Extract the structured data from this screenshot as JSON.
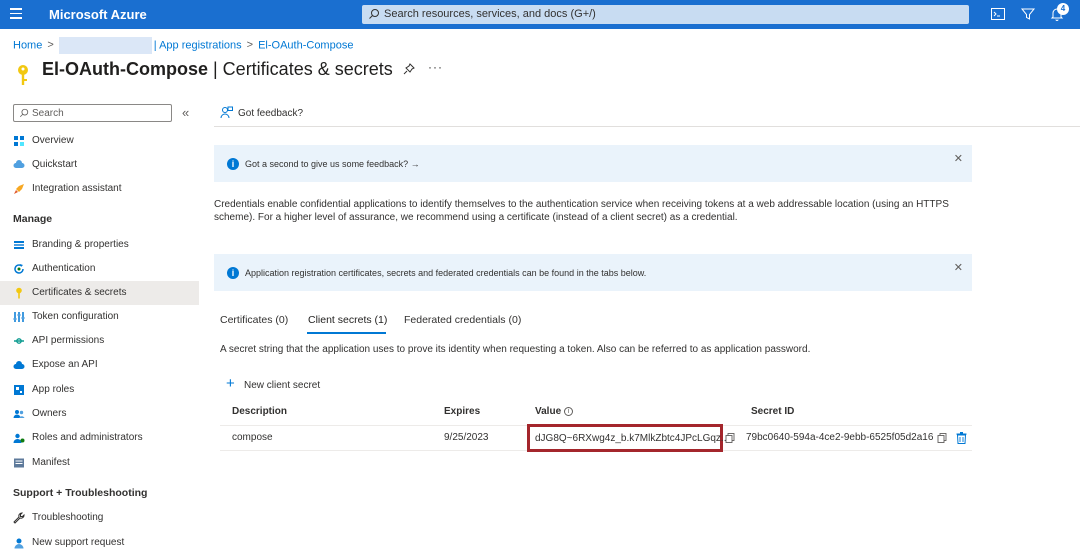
{
  "topbar": {
    "brand": "Microsoft Azure",
    "search_placeholder": "Search resources, services, and docs (G+/)",
    "notification_count": "4"
  },
  "breadcrumb": {
    "home": "Home",
    "app_registrations": "| App registrations",
    "current": "El-OAuth-Compose"
  },
  "page": {
    "title_bold": "El-OAuth-Compose",
    "title_rest": " | Certificates & secrets",
    "more": "···"
  },
  "sidebar": {
    "search_placeholder": "Search",
    "items_top": [
      {
        "label": "Overview",
        "icon": "grid-icon"
      },
      {
        "label": "Quickstart",
        "icon": "cloud-bolt-icon"
      },
      {
        "label": "Integration assistant",
        "icon": "rocket-icon"
      }
    ],
    "manage_heading": "Manage",
    "manage_items": [
      {
        "label": "Branding & properties",
        "icon": "list-icon"
      },
      {
        "label": "Authentication",
        "icon": "refresh-icon"
      },
      {
        "label": "Certificates & secrets",
        "icon": "key-icon",
        "active": true
      },
      {
        "label": "Token configuration",
        "icon": "sliders-icon"
      },
      {
        "label": "API permissions",
        "icon": "permissions-icon"
      },
      {
        "label": "Expose an API",
        "icon": "cloud-icon"
      },
      {
        "label": "App roles",
        "icon": "app-roles-icon"
      },
      {
        "label": "Owners",
        "icon": "people-icon"
      },
      {
        "label": "Roles and administrators",
        "icon": "admin-icon"
      },
      {
        "label": "Manifest",
        "icon": "manifest-icon"
      }
    ],
    "support_heading": "Support + Troubleshooting",
    "support_items": [
      {
        "label": "Troubleshooting",
        "icon": "wrench-icon"
      },
      {
        "label": "New support request",
        "icon": "support-icon"
      }
    ]
  },
  "main": {
    "feedback": "Got feedback?",
    "banner1": "Got a second to give us some feedback? →",
    "description": "Credentials enable confidential applications to identify themselves to the authentication service when receiving tokens at a web addressable location (using an HTTPS scheme). For a higher level of assurance, we recommend using a certificate (instead of a client secret) as a credential.",
    "banner2": "Application registration certificates, secrets and federated credentials can be found in the tabs below.",
    "tabs": [
      "Certificates (0)",
      "Client secrets (1)",
      "Federated credentials (0)"
    ],
    "tab_description": "A secret string that the application uses to prove its identity when requesting a token. Also can be referred to as application password.",
    "new_secret": "New client secret",
    "table": {
      "headers": [
        "Description",
        "Expires",
        "Value",
        "Secret ID"
      ],
      "rows": [
        {
          "description": "compose",
          "expires": "9/25/2023",
          "value": "dJG8Q~6RXwg4z_b.k7MlkZbtc4JPcLGqz...",
          "secret_id": "79bc0640-594a-4ce2-9ebb-6525f05d2a16"
        }
      ]
    }
  },
  "colors": {
    "topbar": "#1a6fd0",
    "accent": "#0078d4",
    "highlight_border": "#a4262c",
    "banner_bg": "#eaf3fb"
  }
}
